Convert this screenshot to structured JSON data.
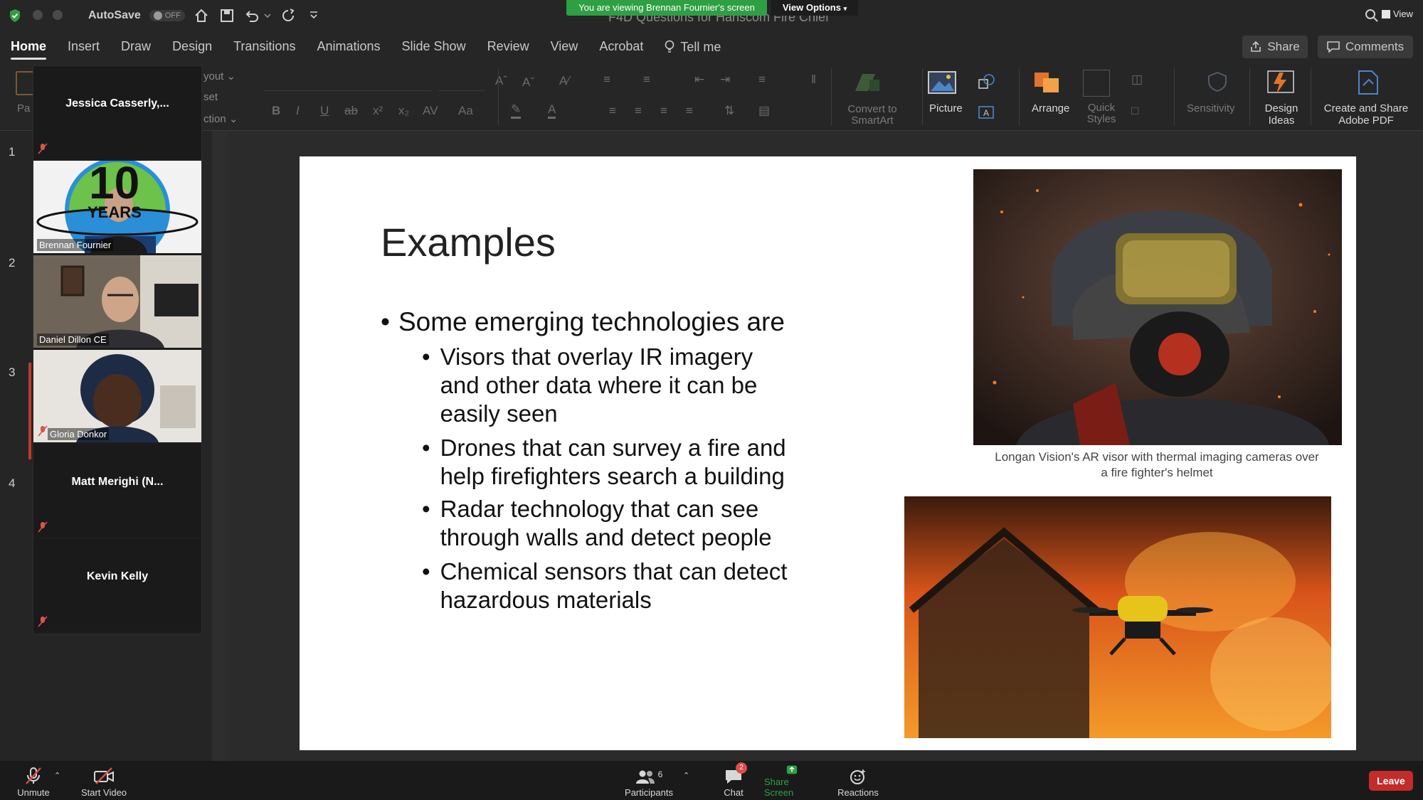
{
  "zoom": {
    "banner": "You are viewing Brennan Fournier's screen",
    "view_options": "View Options",
    "view_label": "View",
    "bottom": {
      "unmute": "Unmute",
      "start_video": "Start Video",
      "participants": "Participants",
      "participant_count": "6",
      "chat": "Chat",
      "chat_badge": "2",
      "share_screen": "Share Screen",
      "reactions": "Reactions",
      "leave": "Leave"
    },
    "participants": [
      {
        "name": "Jessica  Casserly,...",
        "video": false
      },
      {
        "name": "Brennan Fournier",
        "video": true
      },
      {
        "name": "Daniel Dillon CE",
        "video": true
      },
      {
        "name": "Gloria Donkor",
        "video": true
      },
      {
        "name": "Matt  Merighi  (N...",
        "video": false
      },
      {
        "name": "Kevin Kelly",
        "video": false
      }
    ],
    "logo_text": {
      "big": "10",
      "small": "YEARS"
    }
  },
  "ppt": {
    "autosave": "AutoSave",
    "autosave_state": "OFF",
    "doc_title": "F4D Questions for Hanscom Fire Chief",
    "tabs": [
      "Home",
      "Insert",
      "Draw",
      "Design",
      "Transitions",
      "Animations",
      "Slide Show",
      "Review",
      "View",
      "Acrobat"
    ],
    "tell_me": "Tell me",
    "share": "Share",
    "comments": "Comments",
    "ribbon": {
      "paste_partial": "Pa",
      "layout_partial": "yout",
      "reset_partial": "set",
      "section_partial": "ction",
      "convert_smartart": [
        "Convert to",
        "SmartArt"
      ],
      "picture": "Picture",
      "arrange": "Arrange",
      "quick_styles": [
        "Quick",
        "Styles"
      ],
      "sensitivity": "Sensitivity",
      "design_ideas": [
        "Design",
        "Ideas"
      ],
      "create_share_pdf": [
        "Create and Share",
        "Adobe PDF"
      ]
    },
    "slide_numbers": [
      "1",
      "2",
      "3",
      "4"
    ],
    "slide": {
      "title": "Examples",
      "main_bullet": "Some emerging technologies are",
      "sub_bullets": [
        "Visors that overlay IR imagery and other data where it can be easily seen",
        "Drones that can survey a fire and help firefighters search a building",
        "Radar technology that can see through walls and detect people",
        "Chemical sensors that can detect hazardous materials"
      ],
      "caption1": "Longan Vision's AR visor with thermal imaging cameras over a fire fighter's helmet"
    }
  },
  "colors": {
    "accent_green": "#2ea043",
    "leave_red": "#c42b2b",
    "ppt_bg": "#262626"
  }
}
